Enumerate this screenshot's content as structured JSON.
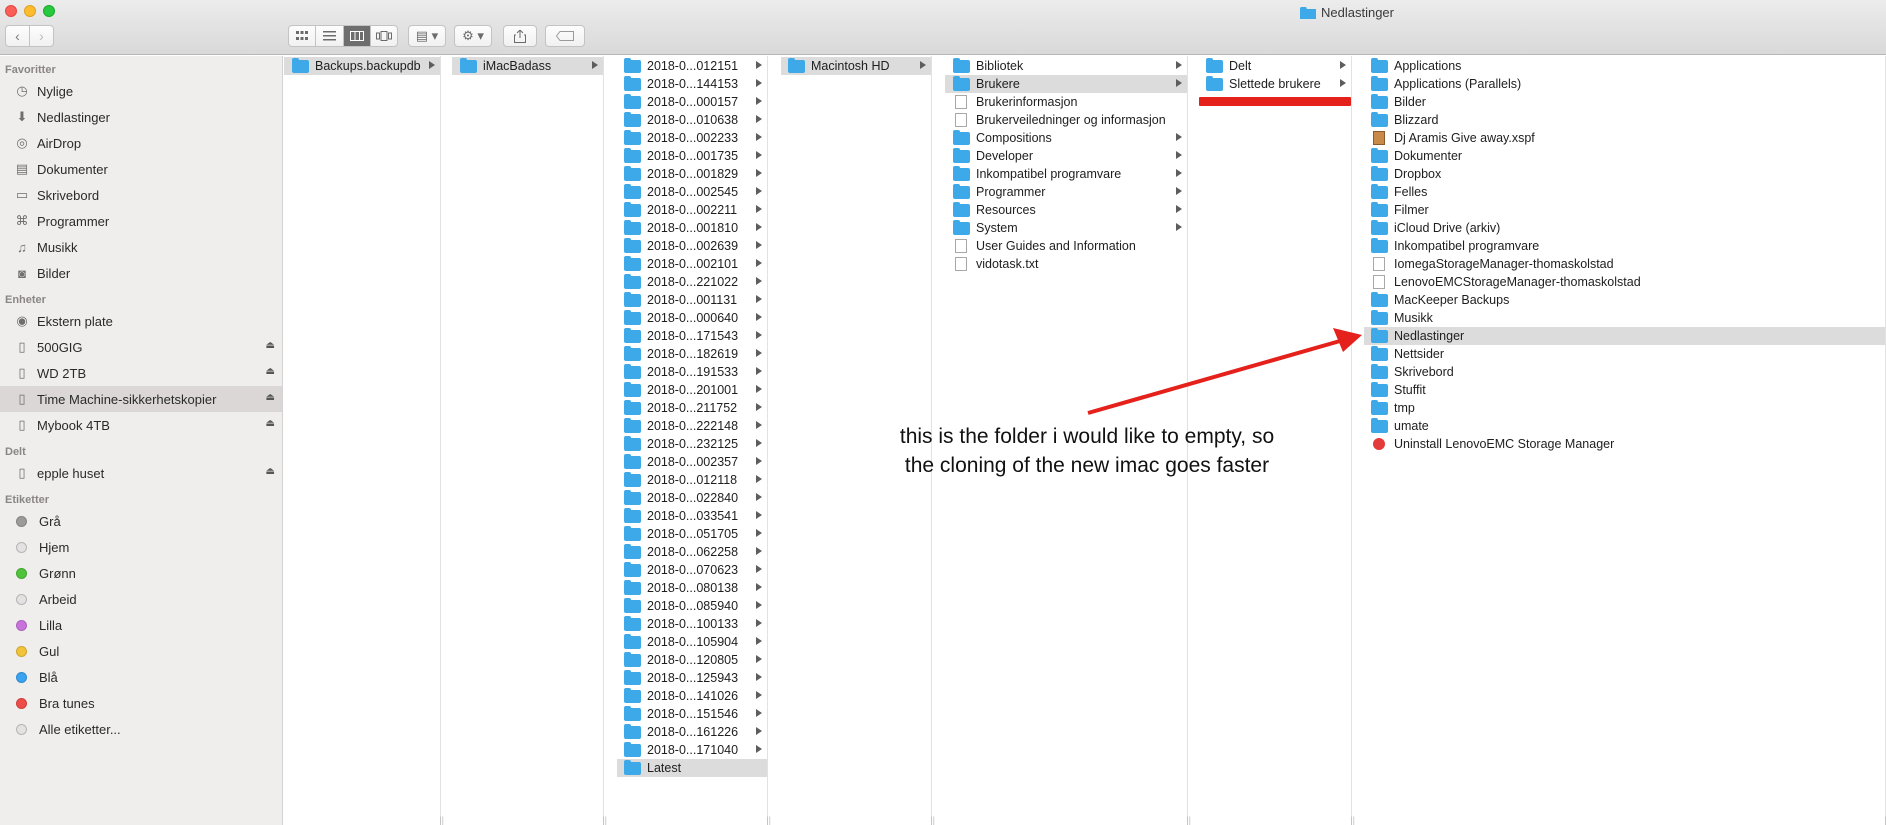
{
  "window": {
    "title": "Nedlastinger"
  },
  "toolbar": {
    "back": "‹",
    "forward": "›",
    "views": [
      "icon-view",
      "list-view",
      "column-view",
      "cover-flow-view"
    ],
    "group_by": "▤ ▾",
    "action": "⚙ ▾"
  },
  "sidebar": {
    "favorites_header": "Favoritter",
    "favorites": [
      {
        "label": "Nylige",
        "icon": "clock-icon"
      },
      {
        "label": "Nedlastinger",
        "icon": "download-icon"
      },
      {
        "label": "AirDrop",
        "icon": "airdrop-icon"
      },
      {
        "label": "Dokumenter",
        "icon": "documents-icon"
      },
      {
        "label": "Skrivebord",
        "icon": "desktop-icon"
      },
      {
        "label": "Programmer",
        "icon": "applications-icon"
      },
      {
        "label": "Musikk",
        "icon": "music-icon"
      },
      {
        "label": "Bilder",
        "icon": "camera-icon"
      }
    ],
    "devices_header": "Enheter",
    "devices": [
      {
        "label": "Ekstern plate",
        "icon": "disk-icon",
        "eject": false
      },
      {
        "label": "500GIG",
        "icon": "drive-icon",
        "eject": true
      },
      {
        "label": "WD 2TB",
        "icon": "drive-icon",
        "eject": true
      },
      {
        "label": "Time Machine-sikkerhetskopier",
        "icon": "drive-icon",
        "eject": true,
        "selected": true
      },
      {
        "label": "Mybook 4TB",
        "icon": "drive-icon",
        "eject": true
      }
    ],
    "shared_header": "Delt",
    "shared": [
      {
        "label": "epple huset",
        "icon": "server-icon",
        "eject": true
      }
    ],
    "tags_header": "Etiketter",
    "tags": [
      {
        "label": "Grå",
        "color": "#9b9b9b"
      },
      {
        "label": "Hjem",
        "color": "#e2e2e2"
      },
      {
        "label": "Grønn",
        "color": "#4fc43a"
      },
      {
        "label": "Arbeid",
        "color": "#e2e2e2"
      },
      {
        "label": "Lilla",
        "color": "#c873dc"
      },
      {
        "label": "Gul",
        "color": "#f2c43a"
      },
      {
        "label": "Blå",
        "color": "#3aa3f2"
      },
      {
        "label": "Bra tunes",
        "color": "#ee4c48"
      },
      {
        "label": "Alle etiketter...",
        "color": "#e2e2e2"
      }
    ]
  },
  "columns": [
    {
      "items": [
        {
          "label": "Backups.backupdb",
          "type": "folder",
          "arrow": true,
          "selected": true
        }
      ]
    },
    {
      "items": [
        {
          "label": "iMacBadass",
          "type": "folder",
          "arrow": true,
          "selected": true
        }
      ]
    },
    {
      "items": [
        {
          "label": "2018-0...012151",
          "type": "folder",
          "arrow": true
        },
        {
          "label": "2018-0...144153",
          "type": "folder",
          "arrow": true
        },
        {
          "label": "2018-0...000157",
          "type": "folder",
          "arrow": true
        },
        {
          "label": "2018-0...010638",
          "type": "folder",
          "arrow": true
        },
        {
          "label": "2018-0...002233",
          "type": "folder",
          "arrow": true
        },
        {
          "label": "2018-0...001735",
          "type": "folder",
          "arrow": true
        },
        {
          "label": "2018-0...001829",
          "type": "folder",
          "arrow": true
        },
        {
          "label": "2018-0...002545",
          "type": "folder",
          "arrow": true
        },
        {
          "label": "2018-0...002211",
          "type": "folder",
          "arrow": true
        },
        {
          "label": "2018-0...001810",
          "type": "folder",
          "arrow": true
        },
        {
          "label": "2018-0...002639",
          "type": "folder",
          "arrow": true
        },
        {
          "label": "2018-0...002101",
          "type": "folder",
          "arrow": true
        },
        {
          "label": "2018-0...221022",
          "type": "folder",
          "arrow": true
        },
        {
          "label": "2018-0...001131",
          "type": "folder",
          "arrow": true
        },
        {
          "label": "2018-0...000640",
          "type": "folder",
          "arrow": true
        },
        {
          "label": "2018-0...171543",
          "type": "folder",
          "arrow": true
        },
        {
          "label": "2018-0...182619",
          "type": "folder",
          "arrow": true
        },
        {
          "label": "2018-0...191533",
          "type": "folder",
          "arrow": true
        },
        {
          "label": "2018-0...201001",
          "type": "folder",
          "arrow": true
        },
        {
          "label": "2018-0...211752",
          "type": "folder",
          "arrow": true
        },
        {
          "label": "2018-0...222148",
          "type": "folder",
          "arrow": true
        },
        {
          "label": "2018-0...232125",
          "type": "folder",
          "arrow": true
        },
        {
          "label": "2018-0...002357",
          "type": "folder",
          "arrow": true
        },
        {
          "label": "2018-0...012118",
          "type": "folder",
          "arrow": true
        },
        {
          "label": "2018-0...022840",
          "type": "folder",
          "arrow": true
        },
        {
          "label": "2018-0...033541",
          "type": "folder",
          "arrow": true
        },
        {
          "label": "2018-0...051705",
          "type": "folder",
          "arrow": true
        },
        {
          "label": "2018-0...062258",
          "type": "folder",
          "arrow": true
        },
        {
          "label": "2018-0...070623",
          "type": "folder",
          "arrow": true
        },
        {
          "label": "2018-0...080138",
          "type": "folder",
          "arrow": true
        },
        {
          "label": "2018-0...085940",
          "type": "folder",
          "arrow": true
        },
        {
          "label": "2018-0...100133",
          "type": "folder",
          "arrow": true
        },
        {
          "label": "2018-0...105904",
          "type": "folder",
          "arrow": true
        },
        {
          "label": "2018-0...120805",
          "type": "folder",
          "arrow": true
        },
        {
          "label": "2018-0...125943",
          "type": "folder",
          "arrow": true
        },
        {
          "label": "2018-0...141026",
          "type": "folder",
          "arrow": true
        },
        {
          "label": "2018-0...151546",
          "type": "folder",
          "arrow": true
        },
        {
          "label": "2018-0...161226",
          "type": "folder",
          "arrow": true
        },
        {
          "label": "2018-0...171040",
          "type": "folder",
          "arrow": true
        },
        {
          "label": "Latest",
          "type": "alias",
          "arrow": false,
          "selected": true
        }
      ]
    },
    {
      "items": [
        {
          "label": "Macintosh HD",
          "type": "folder",
          "arrow": true,
          "selected": true
        }
      ]
    },
    {
      "items": [
        {
          "label": "Bibliotek",
          "type": "folder",
          "arrow": true
        },
        {
          "label": "Brukere",
          "type": "folder",
          "arrow": true,
          "selected": true
        },
        {
          "label": "Brukerinformasjon",
          "type": "doc",
          "arrow": false
        },
        {
          "label": "Brukerveiledninger og informasjon",
          "type": "doc",
          "arrow": false
        },
        {
          "label": "Compositions",
          "type": "folder",
          "arrow": true
        },
        {
          "label": "Developer",
          "type": "folder",
          "arrow": true
        },
        {
          "label": "Inkompatibel programvare",
          "type": "folder",
          "arrow": true
        },
        {
          "label": "Programmer",
          "type": "folder",
          "arrow": true
        },
        {
          "label": "Resources",
          "type": "folder",
          "arrow": true
        },
        {
          "label": "System",
          "type": "folder",
          "arrow": true
        },
        {
          "label": "User Guides and Information",
          "type": "doc",
          "arrow": false
        },
        {
          "label": "vidotask.txt",
          "type": "doc",
          "arrow": false
        }
      ]
    },
    {
      "items": [
        {
          "label": "Delt",
          "type": "folder",
          "arrow": true
        },
        {
          "label": "Slettede brukere",
          "type": "folder",
          "arrow": true
        }
      ]
    },
    {
      "items": [
        {
          "label": "Applications",
          "type": "folder",
          "arrow": false
        },
        {
          "label": "Applications (Parallels)",
          "type": "folder",
          "arrow": false
        },
        {
          "label": "Bilder",
          "type": "folder",
          "arrow": false
        },
        {
          "label": "Blizzard",
          "type": "folder",
          "arrow": false
        },
        {
          "label": "Dj Aramis Give away.xspf",
          "type": "media",
          "arrow": false
        },
        {
          "label": "Dokumenter",
          "type": "folder",
          "arrow": false
        },
        {
          "label": "Dropbox",
          "type": "folder",
          "arrow": false
        },
        {
          "label": "Felles",
          "type": "folder",
          "arrow": false
        },
        {
          "label": "Filmer",
          "type": "folder",
          "arrow": false
        },
        {
          "label": "iCloud Drive (arkiv)",
          "type": "folder",
          "arrow": false
        },
        {
          "label": "Inkompatibel programvare",
          "type": "folder",
          "arrow": false
        },
        {
          "label": "IomegaStorageManager-thomaskolstad",
          "type": "doc",
          "arrow": false
        },
        {
          "label": "LenovoEMCStorageManager-thomaskolstad",
          "type": "doc",
          "arrow": false
        },
        {
          "label": "MacKeeper Backups",
          "type": "folder",
          "arrow": false
        },
        {
          "label": "Musikk",
          "type": "folder",
          "arrow": false
        },
        {
          "label": "Nedlastinger",
          "type": "folder",
          "arrow": false,
          "selected": true
        },
        {
          "label": "Nettsider",
          "type": "folder",
          "arrow": false
        },
        {
          "label": "Skrivebord",
          "type": "folder",
          "arrow": false
        },
        {
          "label": "Stuffit",
          "type": "folder",
          "arrow": false
        },
        {
          "label": "tmp",
          "type": "folder",
          "arrow": false
        },
        {
          "label": "umate",
          "type": "folder",
          "arrow": false
        },
        {
          "label": "Uninstall LenovoEMC Storage Manager",
          "type": "app",
          "arrow": false
        }
      ]
    }
  ],
  "annotation": {
    "line1": "this is the folder i would like to empty, so",
    "line2": "the cloning of the new imac goes faster",
    "arrow_color": "#e5211c"
  }
}
